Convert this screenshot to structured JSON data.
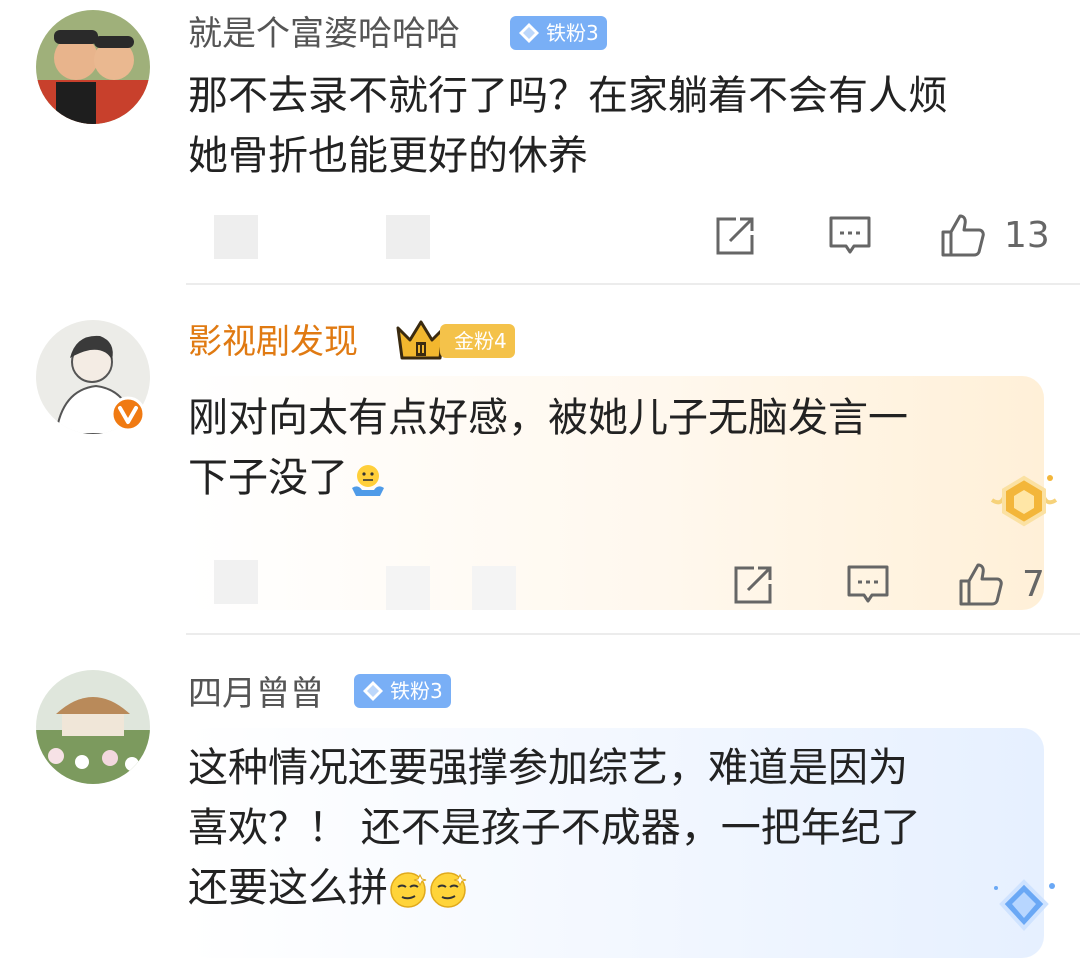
{
  "comments": [
    {
      "username": "就是个富婆哈哈哈",
      "badge": "铁粉3",
      "lines": [
        "那不去录不就行了吗？在家躺着不会有人烦",
        "她骨折也能更好的休养"
      ],
      "likes": "13"
    },
    {
      "username": "影视剧发现",
      "badge": "金粉4",
      "lines": [
        "刚对向太有点好感，被她儿子无脑发言一",
        "下子没了"
      ],
      "likes": "7",
      "emoji_icon": "shrug-emoji-icon"
    },
    {
      "username": "四月曾曾",
      "badge": "铁粉3",
      "lines": [
        "这种情况还要强撑参加综艺，难道是因为",
        "喜欢？！ 还不是孩子不成器，一把年纪了",
        "还要这么拼"
      ],
      "emoji_icon": "smirk-emoji-icon"
    }
  ],
  "icons": [
    "share-icon",
    "comment-icon",
    "like-icon",
    "verified-icon",
    "crown-icon",
    "diamond-icon",
    "medal-icon"
  ],
  "colors": {
    "gold_name": "#e07a12",
    "iron_badge": "#79aff6",
    "gold_badge": "#f4c24a"
  }
}
